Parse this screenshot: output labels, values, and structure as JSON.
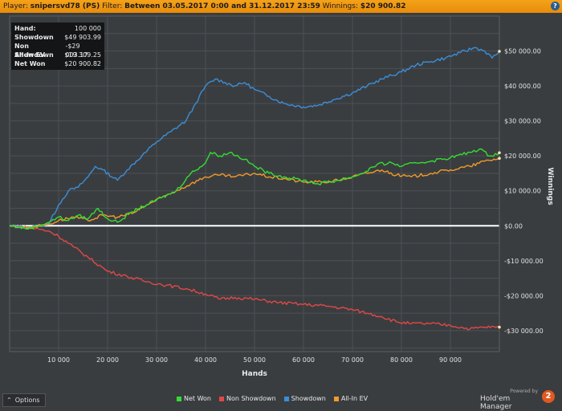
{
  "header": {
    "player_label": "Player:",
    "player": "snipersvd78 (PS)",
    "filter_label": "Filter:",
    "filter": "Between 03.05.2017 0:00 and 31.12.2017 23:59",
    "winnings_label": "Winnings:",
    "winnings": "$20 900.82",
    "help_glyph": "?"
  },
  "stats": [
    {
      "label": "Hand:",
      "value": "100 000"
    },
    {
      "label": "Showdown",
      "value": "$49 903.99"
    },
    {
      "label": "Non Showdown",
      "value": "-$29 003.17"
    },
    {
      "label": "All-In EV",
      "value": "$19 309.25"
    },
    {
      "label": "Net Won",
      "value": "$20 900.82"
    }
  ],
  "options_label": "Options",
  "brand": {
    "powered": "Powered by",
    "name": "Hold'em Manager",
    "badge": "2"
  },
  "chart_data": {
    "type": "line",
    "xlabel": "Hands",
    "ylabel": "Winnings",
    "xlim": [
      0,
      100000
    ],
    "ylim": [
      -36000,
      60000
    ],
    "x_ticks": [
      10000,
      20000,
      30000,
      40000,
      50000,
      60000,
      70000,
      80000,
      90000
    ],
    "x_tick_labels": [
      "10 000",
      "20 000",
      "30 000",
      "40 000",
      "50 000",
      "60 000",
      "70 000",
      "80 000",
      "90 000"
    ],
    "y_ticks": [
      -30000,
      -20000,
      -10000,
      0,
      10000,
      20000,
      30000,
      40000,
      50000
    ],
    "y_tick_labels": [
      "-$30 000.00",
      "-$20 000.00",
      "-$10 000.00",
      "$0.00",
      "$10 000.00",
      "$20 000.00",
      "$30 000.00",
      "$40 000.00",
      "$50 000.00"
    ],
    "grid": true,
    "legend_position": "bottom",
    "series": [
      {
        "name": "Showdown",
        "color": "#3a8fd8",
        "x": [
          0,
          4000,
          8000,
          10000,
          12000,
          14000,
          16000,
          17500,
          19000,
          22000,
          24000,
          27000,
          30000,
          33000,
          36000,
          38000,
          40000,
          42000,
          44000,
          46000,
          48000,
          50000,
          53000,
          56000,
          60000,
          63000,
          66000,
          70000,
          73000,
          76000,
          80000,
          83000,
          86000,
          89000,
          92000,
          95000,
          97000,
          98500,
          100000
        ],
        "values": [
          0,
          -500,
          500,
          6000,
          10000,
          11000,
          14000,
          17000,
          16000,
          13000,
          16000,
          20000,
          24000,
          27000,
          30000,
          35000,
          40000,
          42000,
          41000,
          40000,
          41000,
          39000,
          37000,
          35000,
          34000,
          34500,
          36000,
          38000,
          40000,
          42000,
          44000,
          46000,
          47000,
          48000,
          49500,
          51000,
          50000,
          48000,
          49900
        ]
      },
      {
        "name": "Non Showdown",
        "color": "#e04848",
        "x": [
          0,
          4000,
          8000,
          10000,
          13000,
          16000,
          20000,
          24000,
          28000,
          32000,
          36000,
          40000,
          43000,
          46000,
          50000,
          55000,
          60000,
          65000,
          70000,
          73000,
          76000,
          79000,
          82000,
          86000,
          90000,
          94000,
          97000,
          100000
        ],
        "values": [
          0,
          -500,
          -1500,
          -3000,
          -6000,
          -9000,
          -13000,
          -14500,
          -16000,
          -17000,
          -18000,
          -19500,
          -21000,
          -20500,
          -21000,
          -22000,
          -22500,
          -23000,
          -24000,
          -25000,
          -26000,
          -27500,
          -28000,
          -28000,
          -28500,
          -29500,
          -29000,
          -29000
        ]
      },
      {
        "name": "Net Won",
        "color": "#33dd33",
        "x": [
          0,
          4000,
          8000,
          10000,
          12000,
          14000,
          16000,
          18000,
          20000,
          22000,
          25000,
          28000,
          31000,
          34000,
          37000,
          40000,
          41000,
          43000,
          45000,
          48000,
          50000,
          53000,
          56000,
          60000,
          63000,
          67000,
          70000,
          72000,
          75000,
          78000,
          80000,
          83000,
          86000,
          90000,
          94000,
          96000,
          98000,
          100000
        ],
        "values": [
          0,
          -800,
          1000,
          2500,
          1500,
          3000,
          2000,
          5000,
          2000,
          1000,
          4000,
          6000,
          8000,
          10000,
          15000,
          18000,
          21000,
          20000,
          21000,
          19000,
          17000,
          15000,
          14000,
          13000,
          12000,
          13000,
          14000,
          15000,
          17500,
          18000,
          17000,
          18000,
          18500,
          19500,
          21000,
          22000,
          20000,
          20900
        ]
      },
      {
        "name": "All-In EV",
        "color": "#f39a28",
        "x": [
          0,
          4000,
          8000,
          10000,
          13000,
          16000,
          19000,
          22000,
          25000,
          28000,
          31000,
          34000,
          37000,
          40000,
          43000,
          46000,
          50000,
          53000,
          56000,
          60000,
          64000,
          67000,
          70000,
          73000,
          76000,
          79000,
          82000,
          86000,
          90000,
          94000,
          97000,
          100000
        ],
        "values": [
          0,
          -500,
          500,
          1500,
          2500,
          1500,
          3000,
          2500,
          3500,
          6000,
          8000,
          10000,
          12000,
          14000,
          14500,
          14000,
          15000,
          14000,
          13500,
          12500,
          12500,
          13000,
          14000,
          15000,
          16000,
          14500,
          14000,
          15000,
          16000,
          17000,
          18500,
          19300
        ]
      }
    ]
  }
}
